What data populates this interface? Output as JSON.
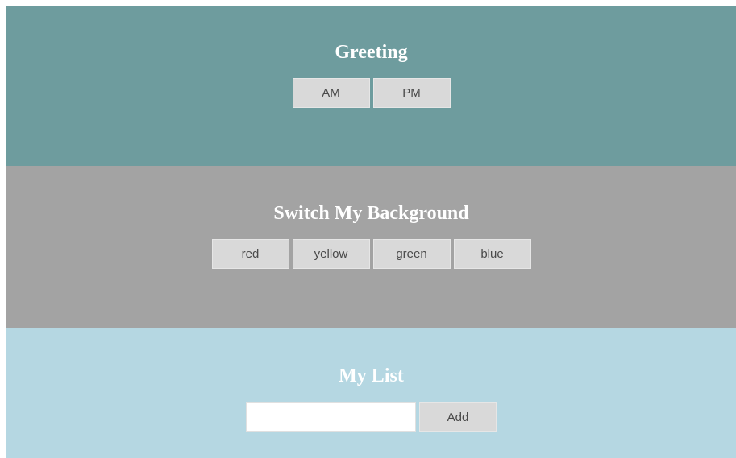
{
  "greeting": {
    "title": "Greeting",
    "buttons": [
      "AM",
      "PM"
    ],
    "background_color": "#6e9c9e"
  },
  "switch_background": {
    "title": "Switch My Background",
    "buttons": [
      "red",
      "yellow",
      "green",
      "blue"
    ],
    "background_color": "#a3a3a3"
  },
  "my_list": {
    "title": "My List",
    "input_value": "",
    "add_label": "Add",
    "background_color": "#b5d7e2"
  }
}
